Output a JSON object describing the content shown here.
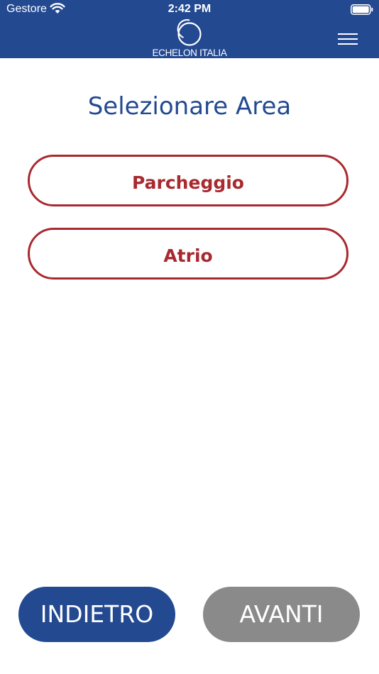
{
  "status_bar": {
    "carrier": "Gestore",
    "time": "2:42 PM"
  },
  "header": {
    "logo_text": "ECHELON ITALIA",
    "background_color": "#234991"
  },
  "main": {
    "title": "Selezionare Area",
    "areas": [
      {
        "label": "Parcheggio"
      },
      {
        "label": "Atrio"
      }
    ],
    "accent_color": "#a8292f"
  },
  "footer": {
    "back_label": "INDIETRO",
    "next_label": "AVANTI",
    "next_disabled_color": "#8a8a8a"
  },
  "icons": [
    "wifi-icon",
    "battery-icon",
    "logo-icon",
    "menu-icon"
  ]
}
